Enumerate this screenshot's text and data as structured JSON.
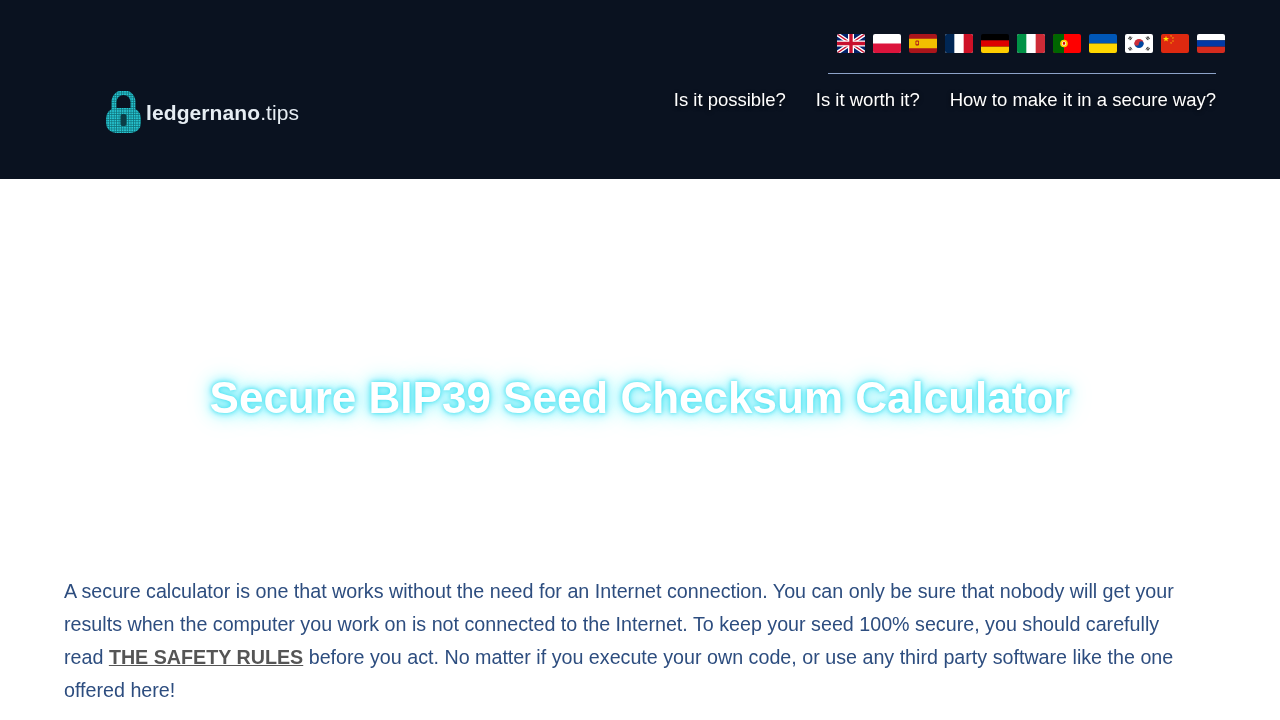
{
  "header": {
    "logo": "**ledgernano**.tips",
    "nav": [
      "Is it possible?",
      "Is it worth it?",
      "How to make it in a secure way?"
    ]
  },
  "hero": {
    "title": "Secure BIP39 Seed Checksum Calculator"
  },
  "intro": {
    "before": "A secure calculator is one that works without the need for an Internet connection. You can only be sure that nobody will get your results when the computer you work on is not connected to the Internet. To keep your seed 100% secure, you should carefully read",
    "link": "THE SAFETY RULES",
    "after": "before you act. No matter if you execute your own code, or use any third party software like the one offered here!"
  }
}
